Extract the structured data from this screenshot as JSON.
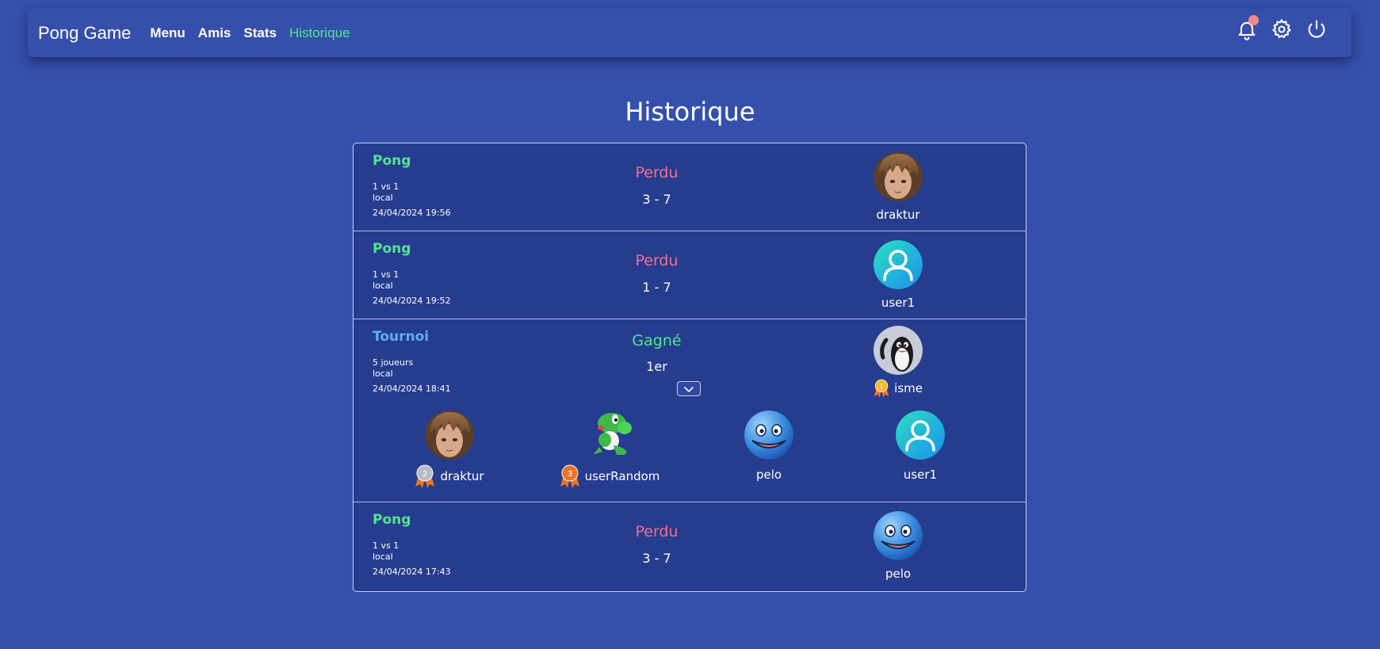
{
  "navbar": {
    "brand": "Pong Game",
    "links": [
      "Menu",
      "Amis",
      "Stats",
      "Historique"
    ],
    "active": "Historique",
    "icons": [
      "bell-icon",
      "gear-icon",
      "power-icon"
    ]
  },
  "page": {
    "title": "Historique"
  },
  "colors": {
    "background": "#3550ab",
    "card": "#263c8e",
    "win": "#4ee88f",
    "loss": "#f26e8c",
    "tournoi": "#5cb0e8"
  },
  "matches": [
    {
      "type": "Pong",
      "mode": "1 vs 1",
      "location": "local",
      "date": "24/04/2024 19:56",
      "result": "Perdu",
      "score": "3 - 7",
      "opponent": "draktur",
      "avatar": "draktur-avatar"
    },
    {
      "type": "Pong",
      "mode": "1 vs 1",
      "location": "local",
      "date": "24/04/2024 19:52",
      "result": "Perdu",
      "score": "1 - 7",
      "opponent": "user1",
      "avatar": "default-user-avatar"
    },
    {
      "type": "Tournoi",
      "mode": "5 joueurs",
      "location": "local",
      "date": "24/04/2024 18:41",
      "result": "Gagné",
      "score": "1er",
      "opponent": "isme",
      "avatar": "penguin-avatar",
      "ranking": [
        {
          "name": "draktur",
          "medal": "2",
          "avatar": "draktur-avatar"
        },
        {
          "name": "userRandom",
          "medal": "3",
          "avatar": "yoshi-avatar"
        },
        {
          "name": "pelo",
          "medal": "",
          "avatar": "blue-slime-avatar"
        },
        {
          "name": "user1",
          "medal": "",
          "avatar": "default-user-avatar"
        }
      ],
      "winner_medal": "1"
    },
    {
      "type": "Pong",
      "mode": "1 vs 1",
      "location": "local",
      "date": "24/04/2024 17:43",
      "result": "Perdu",
      "score": "3 - 7",
      "opponent": "pelo",
      "avatar": "blue-slime-avatar"
    }
  ]
}
